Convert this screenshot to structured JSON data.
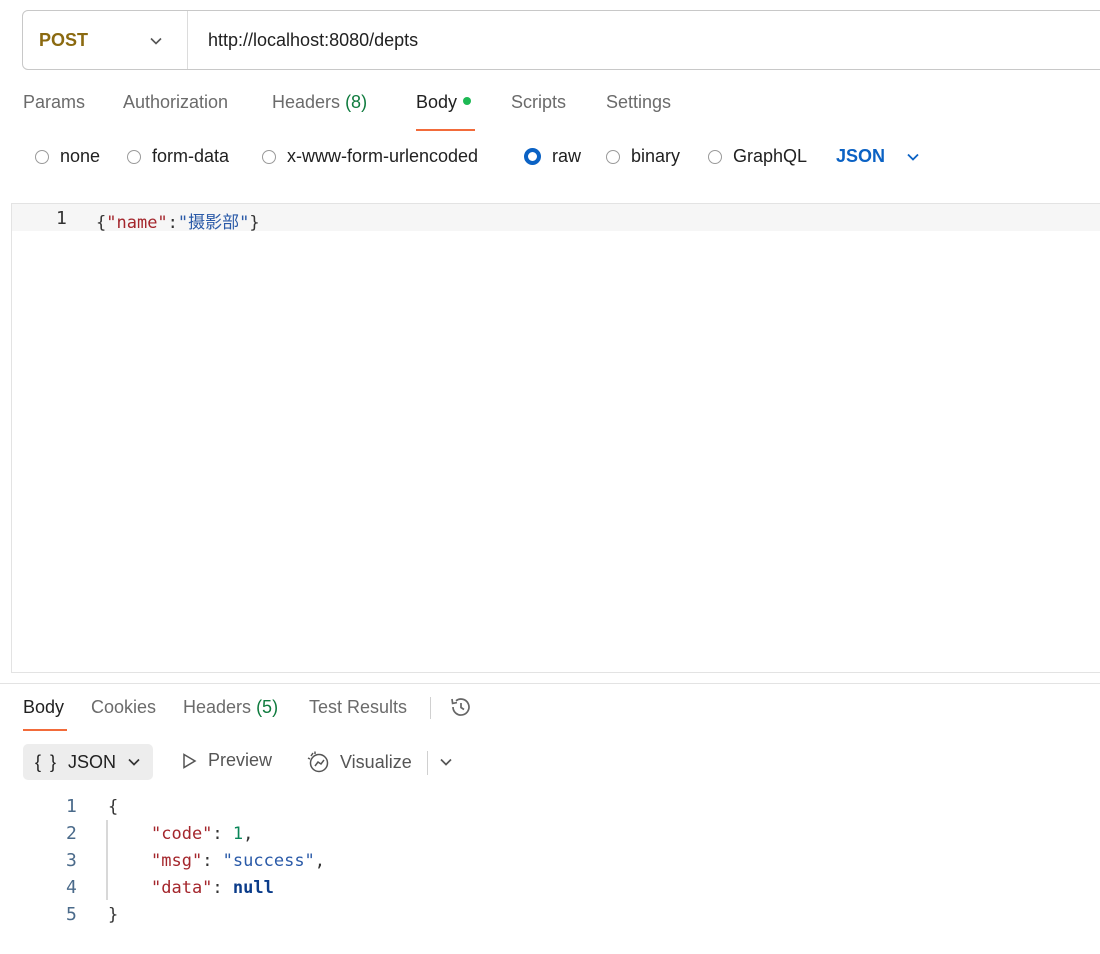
{
  "request": {
    "method": "POST",
    "url": "http://localhost:8080/depts",
    "tabs": [
      {
        "label": "Params"
      },
      {
        "label": "Authorization"
      },
      {
        "label": "Headers",
        "count": "(8)"
      },
      {
        "label": "Body"
      },
      {
        "label": "Scripts"
      },
      {
        "label": "Settings"
      }
    ],
    "active_tab": "Body",
    "body_types": [
      "none",
      "form-data",
      "x-www-form-urlencoded",
      "raw",
      "binary",
      "GraphQL"
    ],
    "selected_body_type": "raw",
    "raw_format": "JSON",
    "editor": {
      "line_number": "1",
      "open_brace": "{",
      "key": "\"name\"",
      "colon": ":",
      "value": "\"摄影部\"",
      "close_brace": "}"
    }
  },
  "response": {
    "tabs": [
      {
        "label": "Body"
      },
      {
        "label": "Cookies"
      },
      {
        "label": "Headers",
        "count": "(5)"
      },
      {
        "label": "Test Results"
      }
    ],
    "active_tab": "Body",
    "format": "JSON",
    "format_icon": "{ }",
    "preview_label": "Preview",
    "visualize_label": "Visualize",
    "line_numbers": [
      "1",
      "2",
      "3",
      "4",
      "5"
    ],
    "lines": {
      "open": "{",
      "code_key": "\"code\"",
      "code_val": "1",
      "msg_key": "\"msg\"",
      "msg_val": "\"success\"",
      "data_key": "\"data\"",
      "data_val": "null",
      "close": "}"
    }
  },
  "icons": {
    "method_dropdown": "chevron-down-icon",
    "format_dropdown": "chevron-down-icon",
    "history": "history-icon",
    "preview": "play-icon",
    "visualize": "visualize-icon"
  },
  "colors": {
    "method": "#8b6a10",
    "accent_underline": "#f26b3a",
    "radio_selected": "#0b62c4",
    "count": "#0f7b3e",
    "json_key": "#a4262c",
    "json_string": "#2a5aa8"
  }
}
